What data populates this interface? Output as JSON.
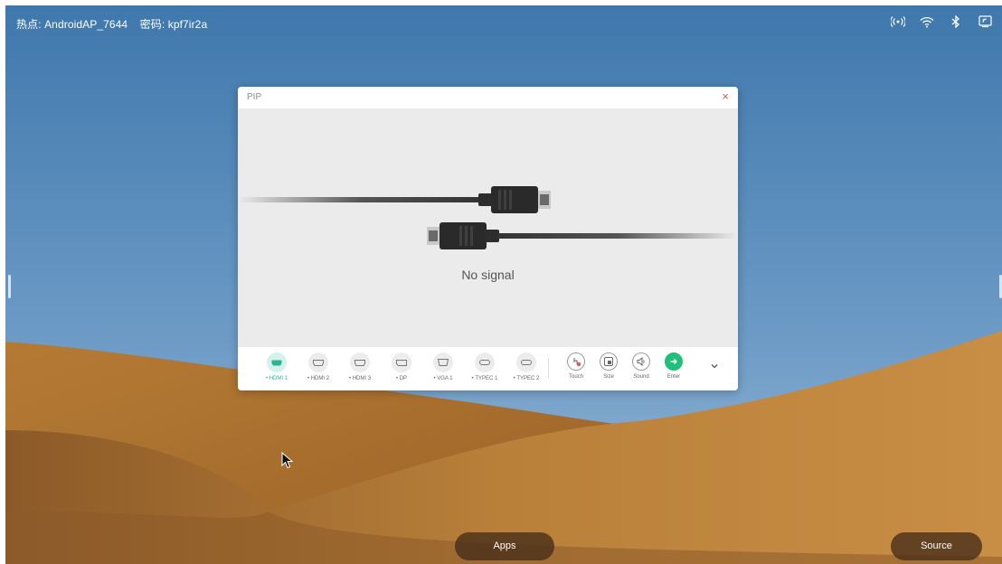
{
  "status_bar": {
    "hotspot_text": "热点: AndroidAP_7644",
    "password_text": "密码: kpf7ir2a",
    "icons": [
      "hotspot-icon",
      "wifi-icon",
      "bluetooth-icon",
      "screen-share-icon"
    ]
  },
  "pip": {
    "title": "PIP",
    "close_label": "×",
    "signal_message": "No signal",
    "sources": [
      {
        "label": "• HDMI 1",
        "icon": "hdmi-icon",
        "active": true
      },
      {
        "label": "• HDMI 2",
        "icon": "hdmi-icon",
        "active": false
      },
      {
        "label": "• HDMI 3",
        "icon": "hdmi-icon",
        "active": false
      },
      {
        "label": "• DP",
        "icon": "displayport-icon",
        "active": false
      },
      {
        "label": "• VGA 1",
        "icon": "vga-icon",
        "active": false
      },
      {
        "label": "• TYPEC 1",
        "icon": "usb-c-icon",
        "active": false
      },
      {
        "label": "• TYPEC 2",
        "icon": "usb-c-icon",
        "active": false
      }
    ],
    "actions": [
      {
        "label": "Touch",
        "icon": "touch-icon"
      },
      {
        "label": "Size",
        "icon": "size-icon"
      },
      {
        "label": "Sound",
        "icon": "sound-icon"
      },
      {
        "label": "Enter",
        "icon": "enter-arrow-icon"
      }
    ]
  },
  "dock": {
    "apps_label": "Apps",
    "source_label": "Source"
  },
  "colors": {
    "accent_green": "#20c07b",
    "active_source": "#2bb596",
    "close_red": "#e2564f"
  }
}
